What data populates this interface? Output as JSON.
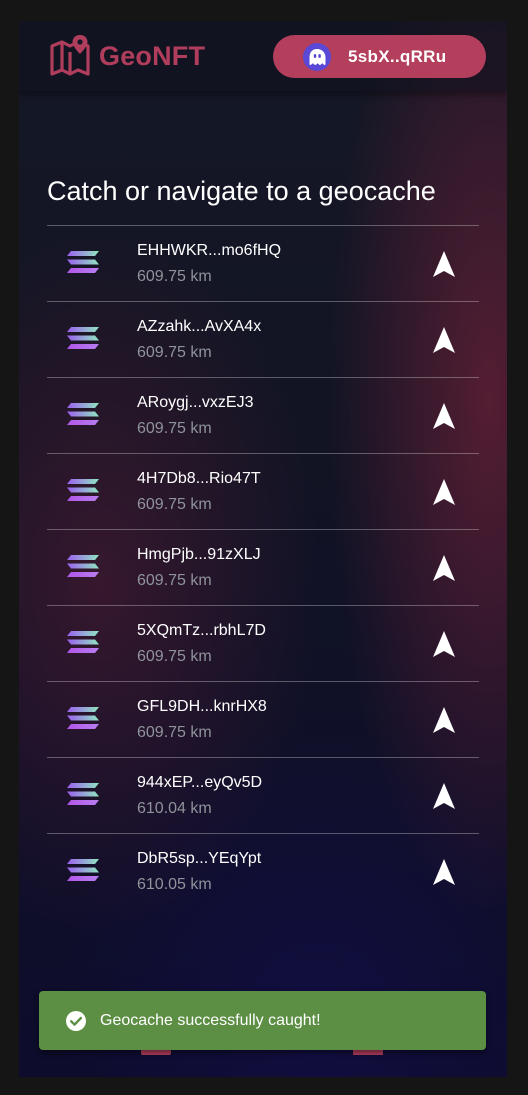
{
  "header": {
    "logo_text": "GeoNFT",
    "wallet_address": "5sbX..qRRu"
  },
  "main": {
    "title": "Catch or navigate to a geocache",
    "geocaches": [
      {
        "name": "EHHWKR...mo6fHQ",
        "distance": "609.75 km"
      },
      {
        "name": "AZzahk...AvXA4x",
        "distance": "609.75 km"
      },
      {
        "name": "ARoygj...vxzEJ3",
        "distance": "609.75 km"
      },
      {
        "name": "4H7Db8...Rio47T",
        "distance": "609.75 km"
      },
      {
        "name": "HmgPjb...91zXLJ",
        "distance": "609.75 km"
      },
      {
        "name": "5XQmTz...rbhL7D",
        "distance": "609.75 km"
      },
      {
        "name": "GFL9DH...knrHX8",
        "distance": "609.75 km"
      },
      {
        "name": "944xEP...eyQv5D",
        "distance": "610.04 km"
      },
      {
        "name": "DbR5sp...YEqYpt",
        "distance": "610.05 km"
      }
    ]
  },
  "toast": {
    "message": "Geocache successfully caught!"
  },
  "icons": {
    "logo": "map-pin-icon",
    "wallet_avatar": "phantom-ghost-icon",
    "list_token": "solana-icon",
    "navigate": "navigation-arrow-icon",
    "toast": "check-circle-icon"
  },
  "colors": {
    "brand": "#b13d5d",
    "wallet_button": "#b33f5d",
    "wallet_avatar": "#5a48d6",
    "toast_success": "#5c8e44"
  }
}
